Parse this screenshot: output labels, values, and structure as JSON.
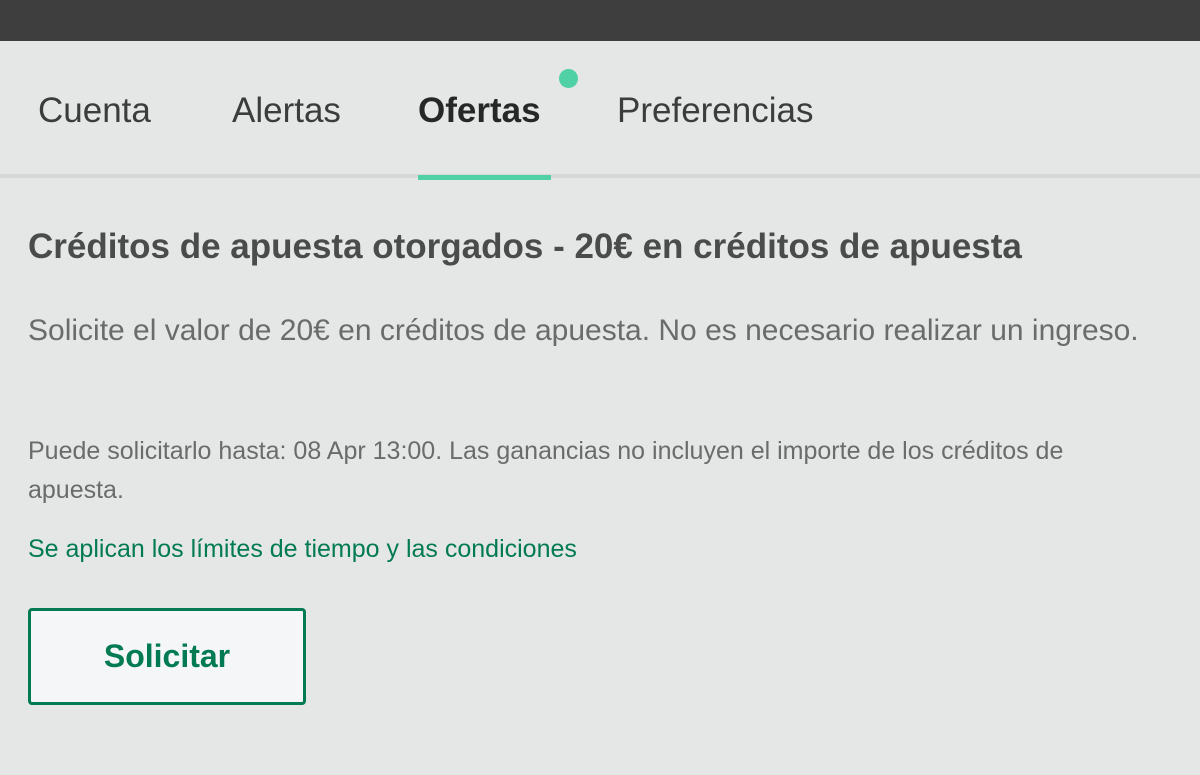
{
  "tabs": [
    {
      "label": "Cuenta",
      "active": false
    },
    {
      "label": "Alertas",
      "active": false
    },
    {
      "label": "Ofertas",
      "active": true,
      "has_notification": true
    },
    {
      "label": "Preferencias",
      "active": false
    }
  ],
  "offer": {
    "title": "Créditos de apuesta otorgados - 20€ en créditos de apuesta",
    "description": "Solicite el valor de 20€ en créditos de apuesta. No es necesario realizar un ingreso.",
    "terms": "Puede solicitarlo hasta: 08 Apr 13:00. Las ganancias no incluyen el importe de los créditos de apuesta.",
    "conditions_link": "Se aplican los límites de tiempo y las condiciones",
    "claim_button_label": "Solicitar"
  },
  "colors": {
    "accent": "#4fd1a5",
    "brand_green": "#027b52",
    "background": "#e5e7e6",
    "topbar": "#3e3e3e"
  }
}
